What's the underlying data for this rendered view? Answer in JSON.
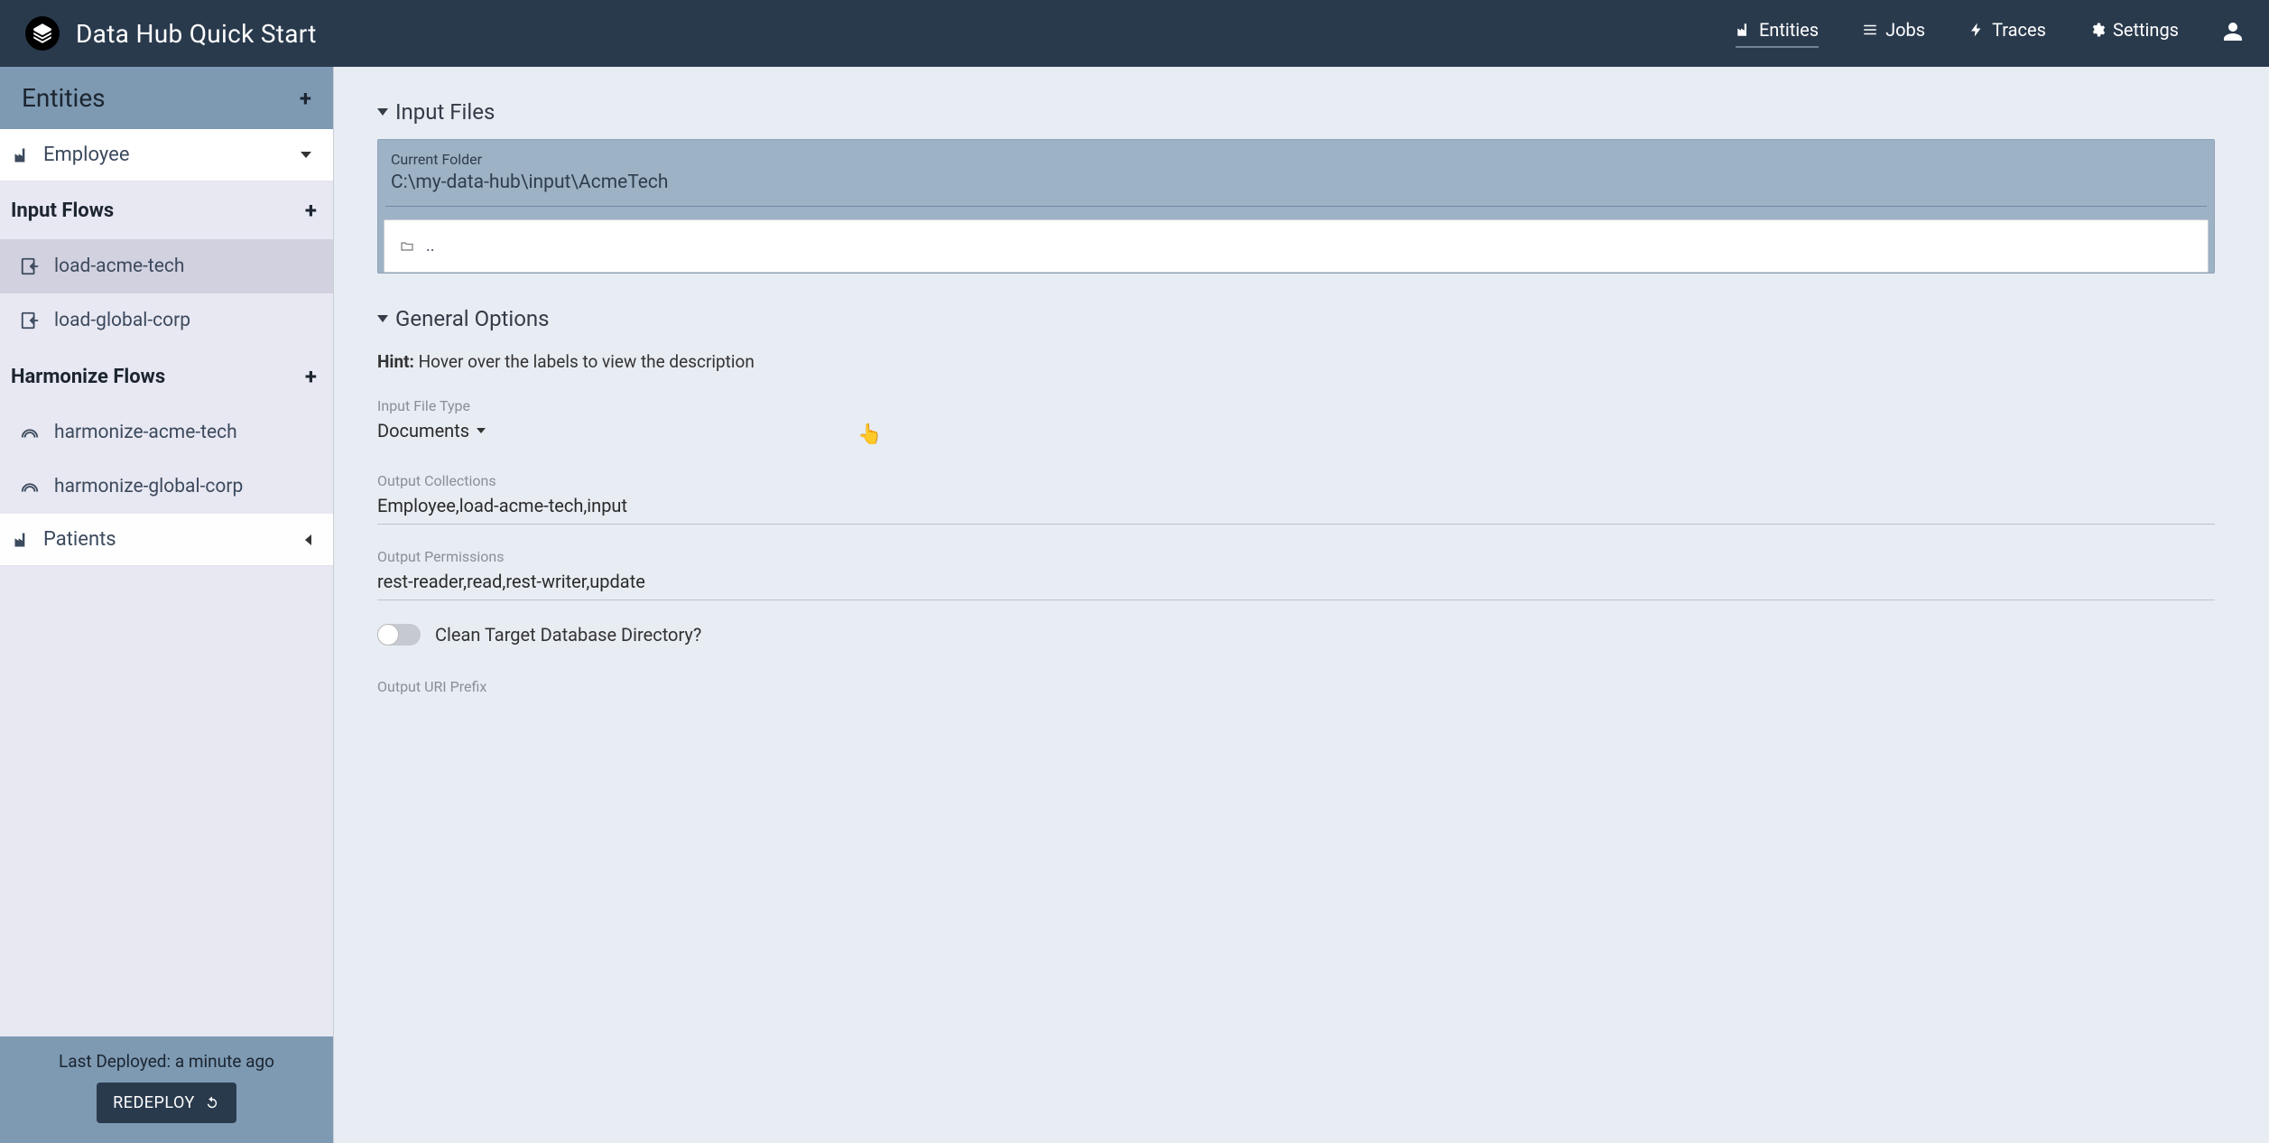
{
  "brand": {
    "title": "Data Hub Quick Start"
  },
  "nav": {
    "entities": "Entities",
    "jobs": "Jobs",
    "traces": "Traces",
    "settings": "Settings"
  },
  "sidebar": {
    "header": "Entities",
    "entities": [
      {
        "name": "Employee",
        "expanded": true
      },
      {
        "name": "Patients",
        "expanded": false
      }
    ],
    "input_flows_label": "Input Flows",
    "input_flows": [
      {
        "name": "load-acme-tech",
        "selected": true
      },
      {
        "name": "load-global-corp",
        "selected": false
      }
    ],
    "harmonize_flows_label": "Harmonize Flows",
    "harmonize_flows": [
      {
        "name": "harmonize-acme-tech"
      },
      {
        "name": "harmonize-global-corp"
      }
    ],
    "footer": {
      "deployed_text": "Last Deployed: a minute ago",
      "redeploy_label": "REDEPLOY"
    }
  },
  "main": {
    "sections": {
      "input_files": {
        "title": "Input Files",
        "current_folder_label": "Current Folder",
        "current_folder_value": "C:\\my-data-hub\\input\\AcmeTech",
        "parent_dir": ".."
      },
      "general_options": {
        "title": "General Options",
        "hint_prefix": "Hint:",
        "hint_text": " Hover over the labels to view the description",
        "input_file_type_label": "Input File Type",
        "input_file_type_value": "Documents",
        "output_collections_label": "Output Collections",
        "output_collections_value": "Employee,load-acme-tech,input",
        "output_permissions_label": "Output Permissions",
        "output_permissions_value": "rest-reader,read,rest-writer,update",
        "clean_target_label": "Clean Target Database Directory?",
        "output_uri_prefix_label": "Output URI Prefix"
      }
    }
  }
}
